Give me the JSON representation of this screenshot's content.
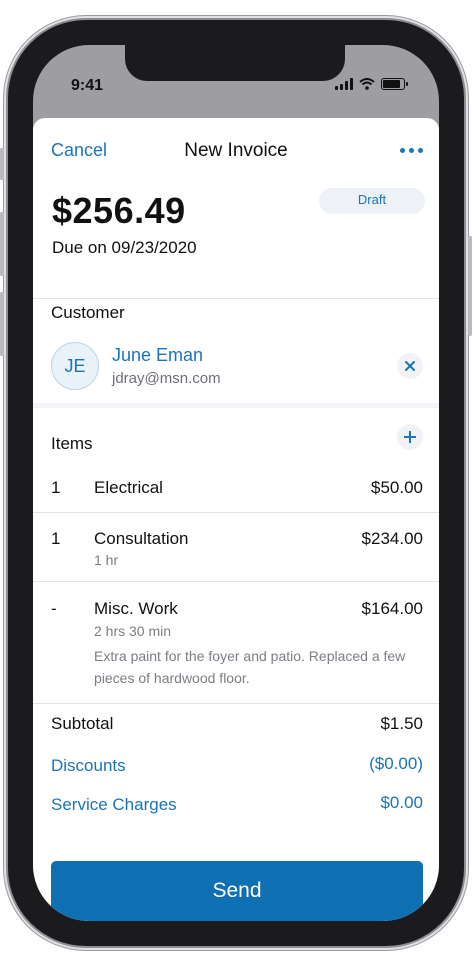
{
  "status_bar": {
    "time": "9:41"
  },
  "nav": {
    "cancel": "Cancel",
    "title": "New Invoice",
    "more_icon": "more-horizontal-icon"
  },
  "invoice": {
    "amount": "$256.49",
    "status": "Draft",
    "due": "Due on 09/23/2020"
  },
  "customer": {
    "label": "Customer",
    "initials": "JE",
    "name": "June Eman",
    "email": "jdray@msn.com",
    "remove_icon": "close-icon"
  },
  "items": {
    "label": "Items",
    "add_icon": "plus-icon",
    "rows": [
      {
        "qty": "1",
        "name": "Electrical",
        "price": "$50.00"
      },
      {
        "qty": "1",
        "name": "Consultation",
        "duration": "1 hr",
        "price": "$234.00"
      },
      {
        "qty": "-",
        "name": "Misc. Work",
        "duration": "2 hrs 30 min",
        "note": "Extra paint for the foyer and patio. Replaced a few pieces of hardwood floor.",
        "price": "$164.00"
      }
    ]
  },
  "summary": {
    "subtotal_label": "Subtotal",
    "subtotal_value": "$1.50",
    "discounts_label": "Discounts",
    "discounts_value": "($0.00)",
    "service_label": "Service Charges",
    "service_value": "$0.00"
  },
  "send_label": "Send",
  "colors": {
    "accent": "#1a74b8",
    "send_button": "#0f6fb3",
    "badge_bg": "#eef1f6"
  }
}
